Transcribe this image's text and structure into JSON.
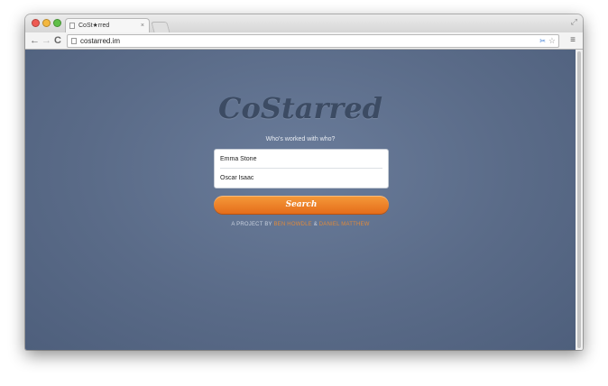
{
  "browser": {
    "tab_title": "CoSt★rred",
    "tab_close": "×",
    "url": "costarred.im"
  },
  "page": {
    "logo": "CoStarred",
    "tagline": "Who's worked with who?",
    "actor1_value": "Emma Stone",
    "actor2_value": "Oscar Isaac",
    "search_label": "Search",
    "credits_prefix": "A PROJECT BY ",
    "author1": "BEN HOWDLE",
    "credits_join": " & ",
    "author2": "DANIEL MATTHEW"
  },
  "colors": {
    "background": "#5a6b88",
    "logo": "#3c4b63",
    "button": "#e8792a",
    "author_link": "#e08a3a"
  },
  "icons": [
    "back-icon",
    "forward-icon",
    "reload-icon",
    "page-icon",
    "extension-icon",
    "star-icon",
    "menu-icon",
    "expand-icon"
  ]
}
